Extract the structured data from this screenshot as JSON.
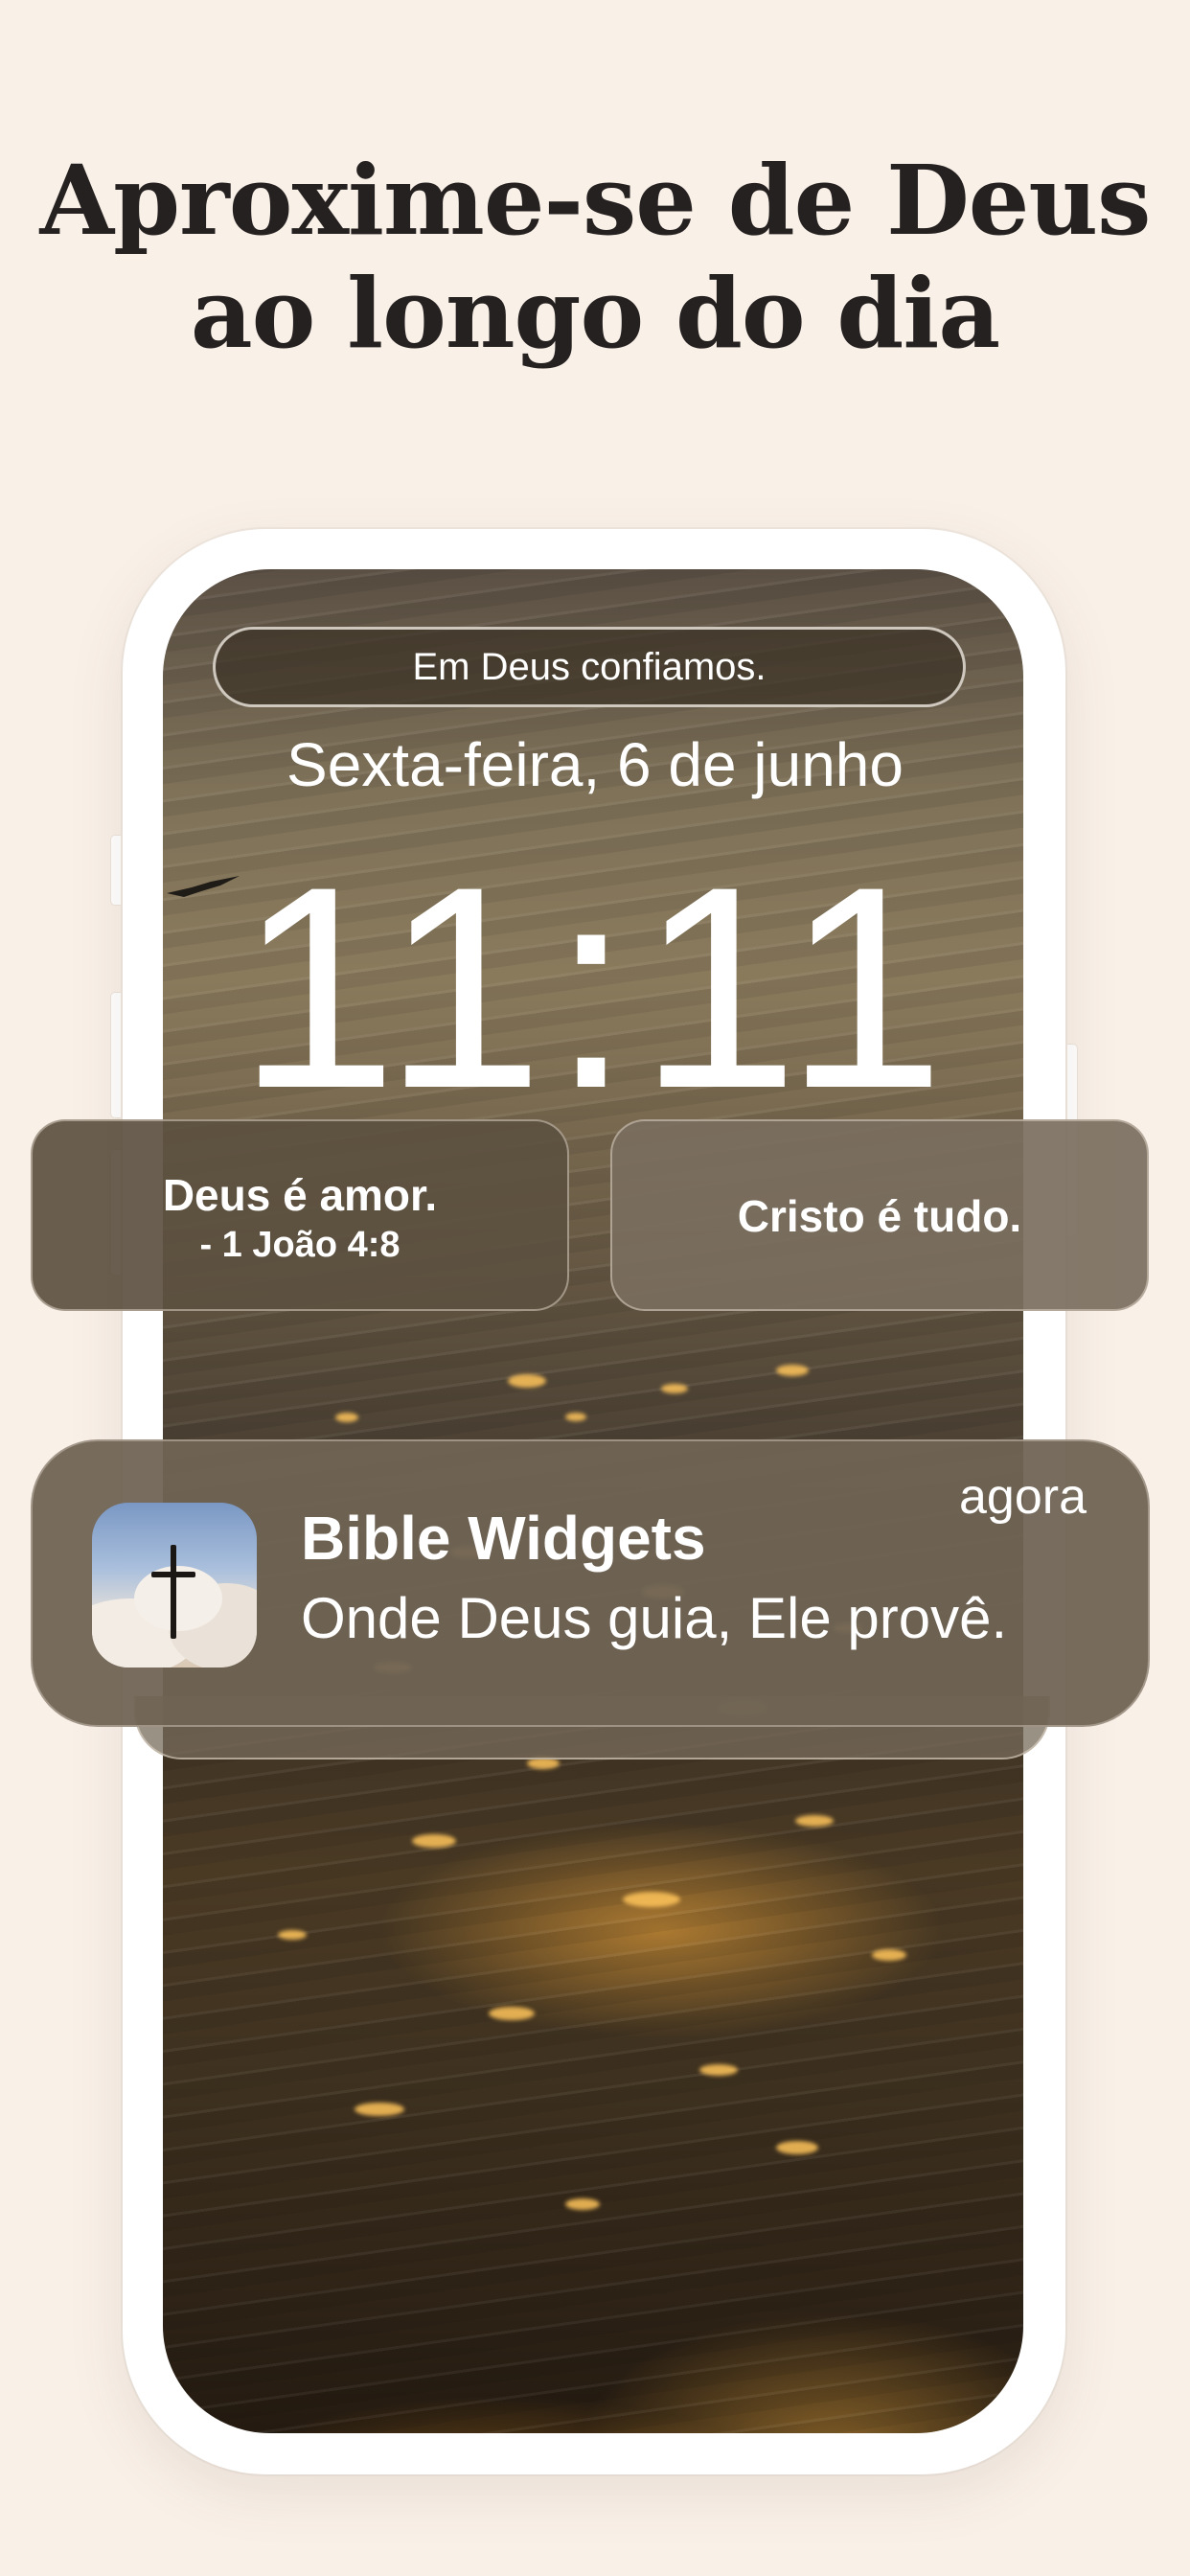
{
  "headline": {
    "line1": "Aproxime-se de Deus",
    "line2": "ao longo do dia"
  },
  "lockscreen": {
    "motto": "Em Deus confiamos.",
    "date": "Sexta-feira, 6 de junho",
    "time": "11:11"
  },
  "widgets": [
    {
      "text": "Deus é amor.",
      "reference": "- 1 João 4:8"
    },
    {
      "text": "Cristo é tudo."
    }
  ],
  "notification": {
    "app_name": "Bible Widgets",
    "message": "Onde Deus guia, Ele provê.",
    "time": "agora",
    "icon": "cross-icon"
  },
  "colors": {
    "background": "#f9f0e8",
    "headline": "#262121",
    "text_on_dark": "#ffffff"
  }
}
